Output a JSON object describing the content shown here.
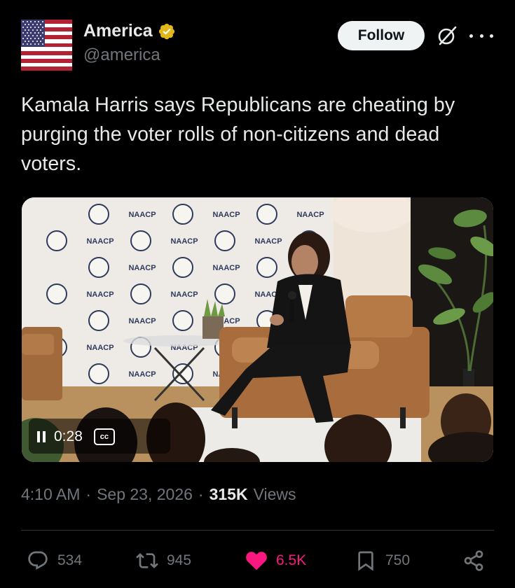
{
  "account": {
    "display_name": "America",
    "handle": "@america",
    "verified_badge": "gold-verified-badge",
    "avatar": "us-flag"
  },
  "header": {
    "follow_label": "Follow",
    "grok_icon": "grok-icon",
    "more_icon": "more-dots-icon"
  },
  "tweet": {
    "text": "Kamala Harris says Republicans are cheating by purging the voter rolls of non-citizens and dead voters."
  },
  "video": {
    "time": "0:28",
    "backdrop_repeated_text": "NAACP",
    "state": "playing"
  },
  "meta": {
    "time": "4:10 AM",
    "separator": "·",
    "date": "Sep 23, 2026",
    "views_count": "315K",
    "views_label": "Views"
  },
  "actions": {
    "reply_count": "534",
    "repost_count": "945",
    "like_count": "6.5K",
    "bookmark_count": "750"
  },
  "colors": {
    "background": "#000000",
    "text": "#e7e9ea",
    "muted": "#71767b",
    "like": "#f91880",
    "verified": "#e2b719"
  }
}
